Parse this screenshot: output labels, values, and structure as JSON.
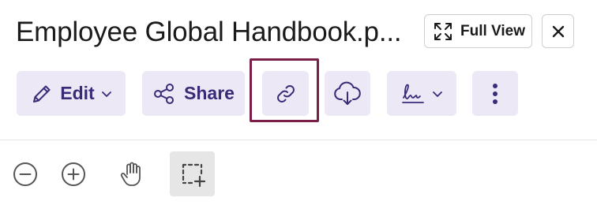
{
  "document": {
    "title": "Employee Global Handbook.p..."
  },
  "header": {
    "full_view_label": "Full View",
    "full_view_icon": "expand-icon",
    "close_icon": "close-icon"
  },
  "toolbar": {
    "edit_label": "Edit",
    "edit_icon": "pencil-icon",
    "share_label": "Share",
    "share_icon": "share-icon",
    "link_icon": "link-icon",
    "download_icon": "cloud-download-icon",
    "sign_icon": "signature-icon",
    "more_icon": "more-vertical-icon"
  },
  "view_tools": {
    "zoom_out_icon": "zoom-out-icon",
    "zoom_in_icon": "zoom-in-icon",
    "pan_icon": "hand-icon",
    "select_icon": "area-select-icon"
  },
  "colors": {
    "button_bg": "#ece8f6",
    "button_fg": "#3b2a78",
    "focus_ring": "#7a2048",
    "active_tool_bg": "#e6e6e6"
  }
}
